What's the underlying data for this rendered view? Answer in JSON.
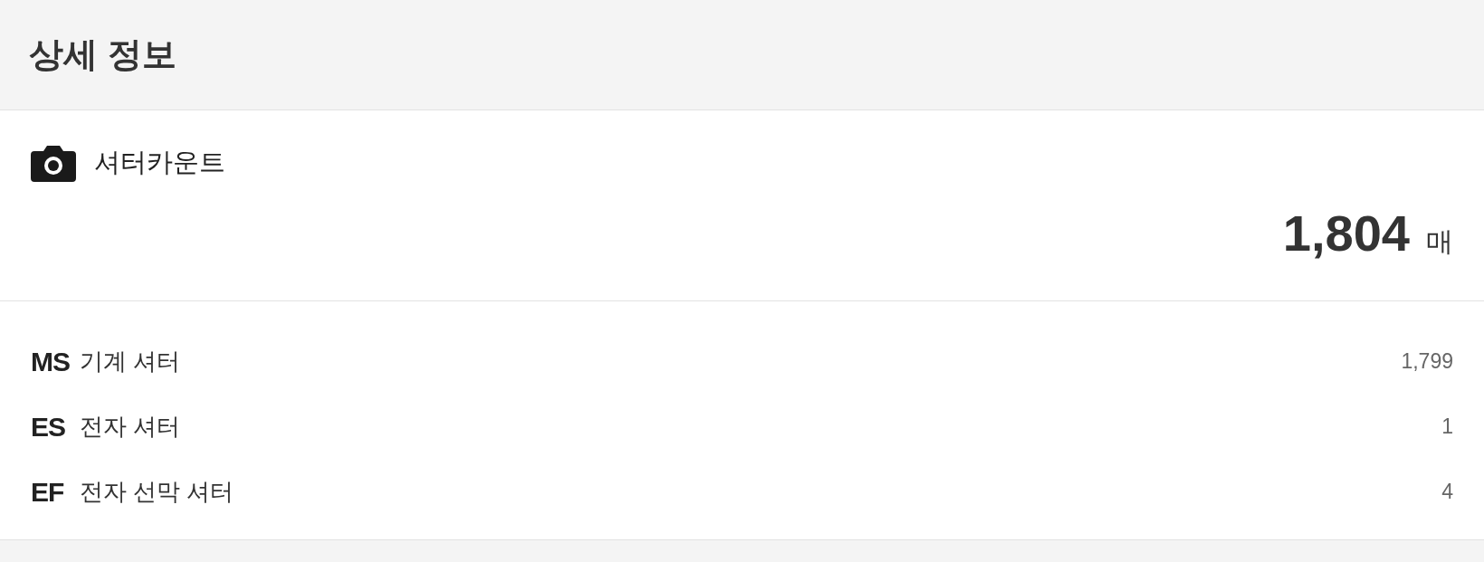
{
  "header": {
    "title": "상세 정보"
  },
  "shutter_count": {
    "label": "셔터카운트",
    "value": "1,804",
    "unit": "매"
  },
  "rows": [
    {
      "code": "MS",
      "label": "기계 셔터",
      "value": "1,799"
    },
    {
      "code": "ES",
      "label": "전자 셔터",
      "value": "1"
    },
    {
      "code": "EF",
      "label": "전자 선막 셔터",
      "value": "4"
    }
  ]
}
